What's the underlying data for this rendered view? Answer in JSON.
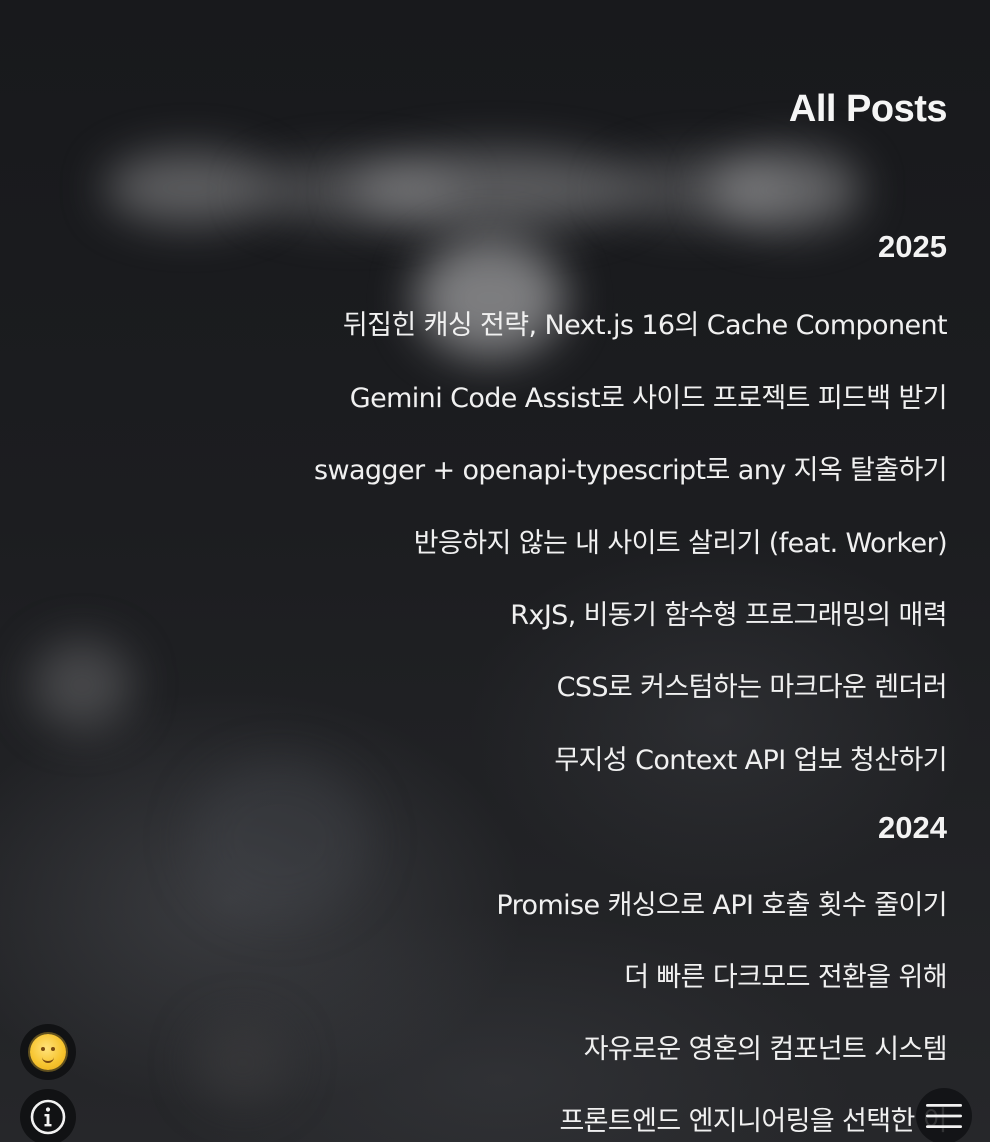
{
  "page_title": "All Posts",
  "groups": [
    {
      "year": "2025",
      "posts": [
        "뒤집힌 캐싱 전략, Next.js 16의 Cache Component",
        "Gemini Code Assist로 사이드 프로젝트 피드백 받기",
        "swagger + openapi-typescript로 any 지옥 탈출하기",
        "반응하지 않는 내 사이트 살리기 (feat. Worker)",
        "RxJS, 비동기 함수형 프로그래밍의 매력",
        "CSS로 커스텀하는 마크다운 렌더러",
        "무지성 Context API 업보 청산하기"
      ]
    },
    {
      "year": "2024",
      "posts": [
        "Promise 캐싱으로 API 호출 횟수 줄이기",
        "더 빠른 다크모드 전환을 위해",
        "자유로운 영혼의 컴포넌트 시스템",
        "프론트엔드 엔지니어링을 선택한 이"
      ]
    }
  ],
  "floating_buttons": {
    "theme_icon": "sun-face-icon",
    "info_icon": "info-icon",
    "menu_icon": "hamburger-menu-icon"
  },
  "colors": {
    "background": "#1a1b1e",
    "text": "#f0f0f0",
    "button_bg": "#111214",
    "sun": "#f7c531"
  }
}
